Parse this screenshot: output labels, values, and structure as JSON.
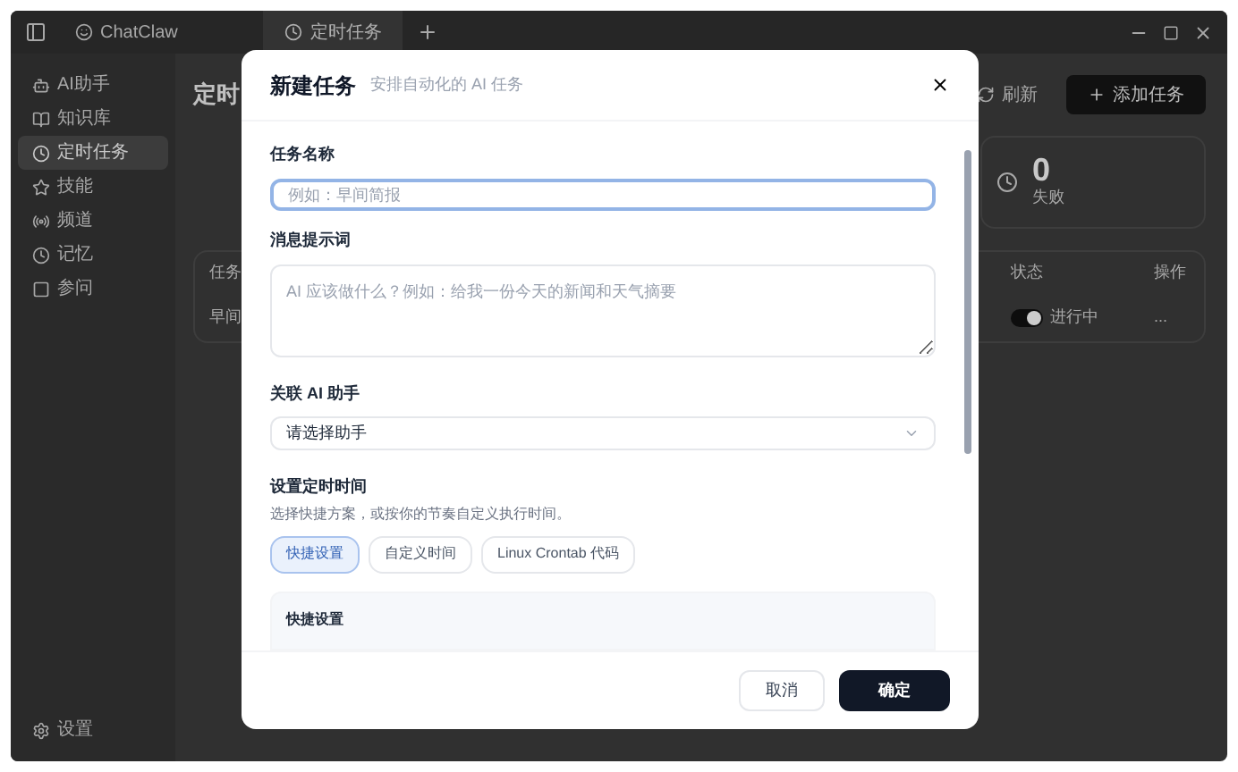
{
  "window": {
    "tabs": [
      {
        "label": "ChatClaw",
        "selected": false
      },
      {
        "label": "定时任务",
        "selected": true
      }
    ]
  },
  "sidebar": {
    "items": [
      {
        "label": "AI助手",
        "selected": false
      },
      {
        "label": "知识库",
        "selected": false
      },
      {
        "label": "定时任务",
        "selected": true
      },
      {
        "label": "技能",
        "selected": false
      },
      {
        "label": "频道",
        "selected": false
      },
      {
        "label": "记忆",
        "selected": false
      },
      {
        "label": "参问",
        "selected": false
      }
    ],
    "settings": "设置"
  },
  "main": {
    "title": "定时",
    "refresh": "刷新",
    "add": "添加任务",
    "stat": {
      "value": "0",
      "label": "失败"
    },
    "columns": [
      "任务",
      "状态",
      "操作"
    ],
    "rows": [
      {
        "name": "早间",
        "status": "进行中",
        "on": true,
        "action": "..."
      }
    ]
  },
  "dialog": {
    "title": "新建任务",
    "subtitle": "安排自动化的 AI 任务",
    "task_name": {
      "label": "任务名称",
      "placeholder": "例如：早间简报"
    },
    "prompt": {
      "label": "消息提示词",
      "placeholder": "AI 应该做什么？例如：给我一份今天的新闻和天气摘要"
    },
    "assistant": {
      "label": "关联 AI 助手",
      "placeholder": "请选择助手"
    },
    "schedule": {
      "label": "设置定时时间",
      "hint": "选择快捷方案，或按你的节奏自定义执行时间。",
      "modes": [
        {
          "label": "快捷设置",
          "selected": true
        },
        {
          "label": "自定义时间",
          "selected": false
        },
        {
          "label": "Linux Crontab 代码",
          "selected": false
        }
      ],
      "section_title": "快捷设置"
    },
    "cancel": "取消",
    "confirm": "确定"
  }
}
